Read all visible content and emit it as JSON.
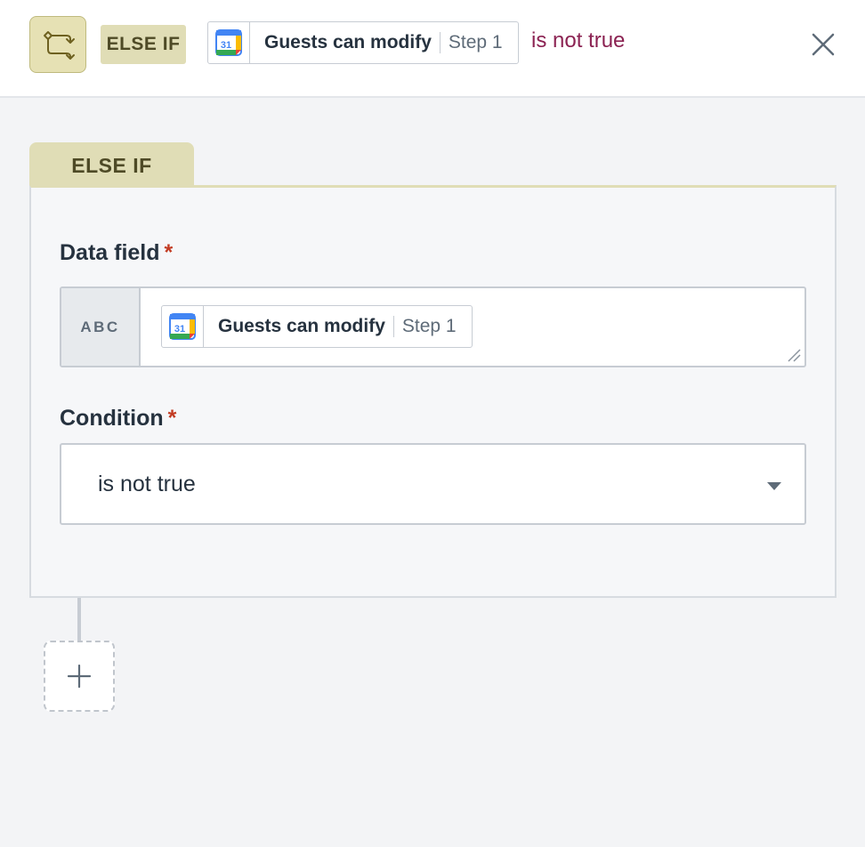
{
  "header": {
    "tag_label": "ELSE IF",
    "field_pill": {
      "field": "Guests can modify",
      "step": "Step 1",
      "app_icon": "google-calendar-icon"
    },
    "condition_text": "is not true",
    "close_icon": "close-icon"
  },
  "block": {
    "tab_label": "ELSE IF",
    "data_field": {
      "label": "Data field",
      "required_mark": "*",
      "type_badge": "ABC",
      "pill": {
        "field": "Guests can modify",
        "step": "Step 1",
        "calendar_day": "31"
      }
    },
    "condition": {
      "label": "Condition",
      "required_mark": "*",
      "selected": "is not true"
    }
  },
  "calendar_day": "31",
  "add_step_icon": "plus-icon",
  "colors": {
    "accent_tag_bg": "#e0ddb6",
    "accent_tag_text": "#4e4a26",
    "condition_text": "#8b2252",
    "required": "#c23b22"
  }
}
